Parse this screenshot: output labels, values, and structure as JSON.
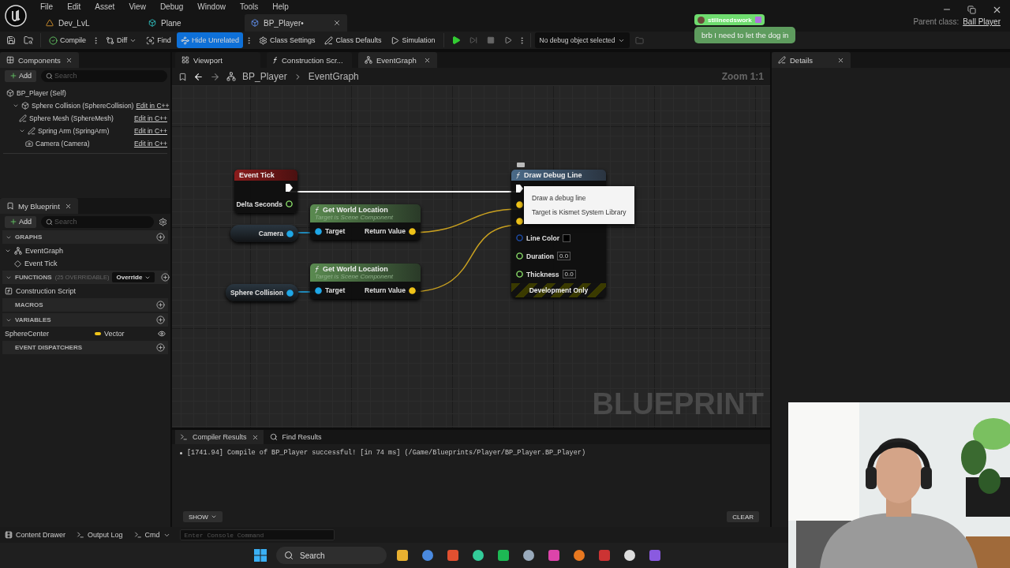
{
  "menu": [
    "File",
    "Edit",
    "Asset",
    "View",
    "Debug",
    "Window",
    "Tools",
    "Help"
  ],
  "document_tabs": [
    {
      "label": "Dev_LvL",
      "selected": false
    },
    {
      "label": "Plane",
      "selected": false
    },
    {
      "label": "BP_Player•",
      "selected": true
    }
  ],
  "parent_class": {
    "label": "Parent class:",
    "value": "Ball Player"
  },
  "chat": {
    "user": "stillneedswork",
    "message": "brb I need to let the dog in"
  },
  "toolbar": {
    "items": [
      {
        "kind": "compile",
        "label": "Compile"
      },
      {
        "kind": "diff",
        "label": "Diff"
      },
      {
        "kind": "find",
        "label": "Find"
      },
      {
        "kind": "hide",
        "label": "Hide Unrelated",
        "active": true
      },
      {
        "kind": "settings",
        "label": "Class Settings"
      },
      {
        "kind": "defaults",
        "label": "Class Defaults"
      },
      {
        "kind": "simulation",
        "label": "Simulation"
      }
    ],
    "debug_object": "No debug object selected"
  },
  "components": {
    "title": "Components",
    "add": "Add",
    "search_placeholder": "Search",
    "tree": [
      {
        "label": "BP_Player (Self)",
        "children": [
          {
            "label": "Sphere Collision (SphereCollision)",
            "action": "Edit in C++",
            "expanded": true,
            "children": [
              {
                "label": "Sphere Mesh (SphereMesh)",
                "action": "Edit in C++"
              },
              {
                "label": "Spring Arm (SpringArm)",
                "action": "Edit in C++",
                "expanded": true,
                "children": [
                  {
                    "label": "Camera (Camera)",
                    "action": "Edit in C++"
                  }
                ]
              }
            ]
          }
        ]
      }
    ]
  },
  "my_blueprint": {
    "title": "My Blueprint",
    "add": "Add",
    "search_placeholder": "Search",
    "sections": [
      {
        "title": "GRAPHS",
        "expanded": true,
        "items": [
          {
            "label": "EventGraph",
            "kind": "graph",
            "expanded": true,
            "children": [
              {
                "label": "Event Tick",
                "kind": "event"
              }
            ]
          }
        ]
      },
      {
        "title": "FUNCTIONS",
        "note": "(25 OVERRIDABLE)",
        "dropdown": "Override",
        "expanded": true,
        "items": [
          {
            "label": "Construction Script",
            "kind": "function"
          }
        ]
      },
      {
        "title": "MACROS"
      },
      {
        "title": "VARIABLES",
        "expanded": true,
        "items": [
          {
            "label": "SphereCenter",
            "kind": "variable",
            "type": "Vector",
            "color": "#f0c419"
          }
        ]
      },
      {
        "title": "EVENT DISPATCHERS"
      }
    ]
  },
  "graph": {
    "tabs": [
      {
        "label": "Viewport",
        "selected": false
      },
      {
        "label": "Construction Scr...",
        "selected": false
      },
      {
        "label": "EventGraph",
        "selected": true
      }
    ],
    "breadcrumb": [
      "BP_Player",
      "EventGraph"
    ],
    "zoom": "Zoom 1:1",
    "watermark": "BLUEPRINT",
    "nodes": [
      {
        "kind": "event",
        "title": "Event Tick",
        "outputs": [
          {
            "label": "Delta Seconds",
            "kind": "float"
          }
        ]
      },
      {
        "kind": "variable",
        "title": "Camera"
      },
      {
        "kind": "function",
        "title": "Get World Location",
        "subtitle": "Target is Scene Component",
        "inputs": [
          {
            "label": "Target",
            "kind": "object"
          }
        ],
        "outputs": [
          {
            "label": "Return Value",
            "kind": "vector"
          }
        ]
      },
      {
        "kind": "variable",
        "title": "Sphere Collision"
      },
      {
        "kind": "function",
        "title": "Get World Location",
        "subtitle": "Target is Scene Component",
        "inputs": [
          {
            "label": "Target",
            "kind": "object"
          }
        ],
        "outputs": [
          {
            "label": "Return Value",
            "kind": "vector"
          }
        ]
      },
      {
        "kind": "debug",
        "title": "Draw Debug Line",
        "inputs": [
          {
            "label": "Line Color",
            "kind": "color"
          },
          {
            "label": "Duration",
            "kind": "float",
            "value": "0.0"
          },
          {
            "label": "Thickness",
            "kind": "float",
            "value": "0.0"
          }
        ],
        "footer": "Development Only"
      }
    ],
    "tooltip": [
      "Draw a debug line",
      "Target is Kismet System Library"
    ]
  },
  "details": {
    "title": "Details"
  },
  "output": {
    "tabs": [
      {
        "label": "Compiler Results",
        "selected": true
      },
      {
        "label": "Find Results",
        "selected": false
      }
    ],
    "messages": [
      "[1741.94] Compile of BP_Player successful! [in 74 ms] (/Game/Blueprints/Player/BP_Player.BP_Player)"
    ],
    "show": "SHOW",
    "clear": "CLEAR"
  },
  "status_bar": {
    "items": [
      "Content Drawer",
      "Output Log",
      "Cmd"
    ],
    "console_placeholder": "Enter Console Command"
  },
  "taskbar": {
    "search": "Search"
  }
}
